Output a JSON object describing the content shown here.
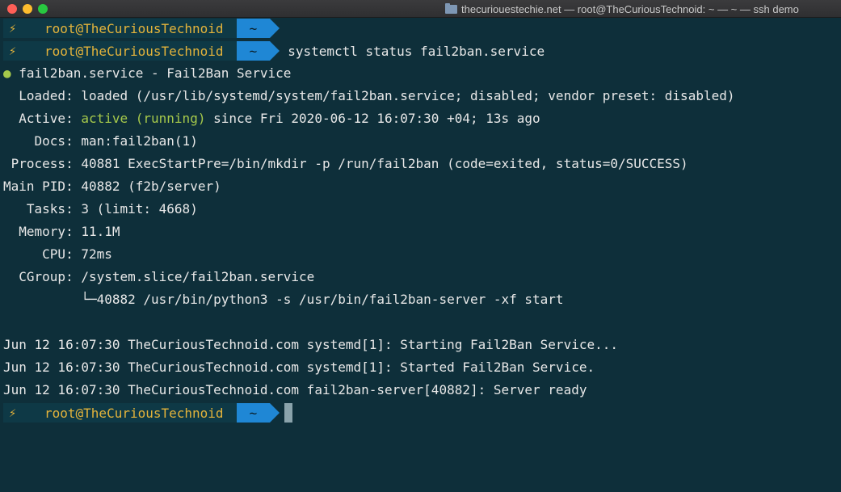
{
  "window": {
    "title": "thecuriouestechie.net — root@TheCuriousTechnoid: ~ — ~ — ssh demo"
  },
  "prompt": {
    "bolt": "⚡",
    "user": "root@TheCuriousTechnoid",
    "dir": "~"
  },
  "command": "systemctl status fail2ban.service",
  "status": {
    "bullet": "●",
    "header": " fail2ban.service - Fail2Ban Service",
    "loaded": "  Loaded: loaded (/usr/lib/systemd/system/fail2ban.service; disabled; vendor preset: disabled)",
    "active_label": "  Active: ",
    "active_state": "active (running)",
    "active_rest": " since Fri 2020-06-12 16:07:30 +04; 13s ago",
    "docs": "    Docs: man:fail2ban(1)",
    "process": " Process: 40881 ExecStartPre=/bin/mkdir -p /run/fail2ban (code=exited, status=0/SUCCESS)",
    "main_pid": "Main PID: 40882 (f2b/server)",
    "tasks": "   Tasks: 3 (limit: 4668)",
    "memory": "  Memory: 11.1M",
    "cpu": "     CPU: 72ms",
    "cgroup": "  CGroup: /system.slice/fail2ban.service",
    "cgroup_child": "          └─40882 /usr/bin/python3 -s /usr/bin/fail2ban-server -xf start"
  },
  "logs": [
    "Jun 12 16:07:30 TheCuriousTechnoid.com systemd[1]: Starting Fail2Ban Service...",
    "Jun 12 16:07:30 TheCuriousTechnoid.com systemd[1]: Started Fail2Ban Service.",
    "Jun 12 16:07:30 TheCuriousTechnoid.com fail2ban-server[40882]: Server ready"
  ]
}
